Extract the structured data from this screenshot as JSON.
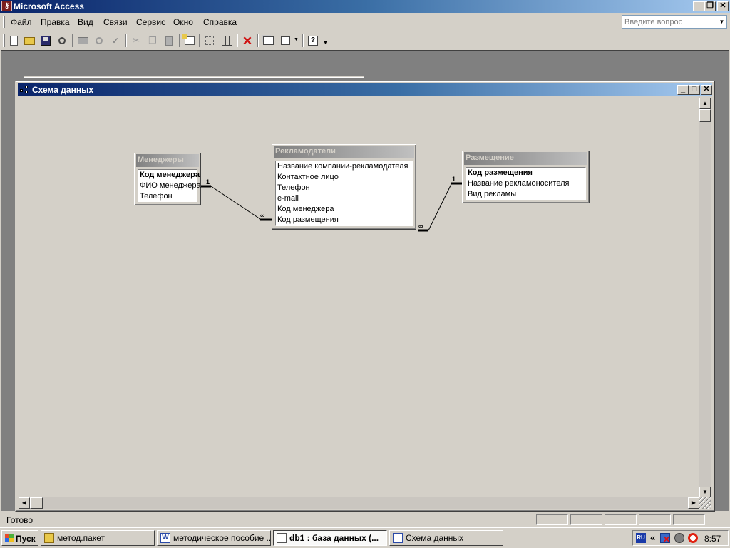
{
  "app": {
    "title": "Microsoft Access",
    "icon": "access-key-icon",
    "caption_buttons": {
      "minimize": "_",
      "restore": "❐",
      "close": "✕"
    }
  },
  "menu": {
    "items": [
      "Файл",
      "Правка",
      "Вид",
      "Связи",
      "Сервис",
      "Окно",
      "Справка"
    ],
    "help_placeholder": "Введите вопрос"
  },
  "toolbar": {
    "buttons": [
      "new-icon",
      "open-icon",
      "save-icon",
      "file-search-icon",
      "print-icon",
      "print-preview-icon",
      "spelling-icon",
      "cut-icon",
      "copy-icon",
      "paste-icon",
      "show-table-icon",
      "show-direct-icon",
      "show-all-icon",
      "delete-icon",
      "database-window-icon",
      "new-object-icon",
      "help-icon"
    ]
  },
  "child_window": {
    "title": "Схема данных",
    "icon": "relationships-icon"
  },
  "tables": [
    {
      "name": "Менеджеры",
      "fields": [
        {
          "label": "Код менеджера",
          "key": true
        },
        {
          "label": "ФИО менеджера",
          "key": false
        },
        {
          "label": "Телефон",
          "key": false
        }
      ]
    },
    {
      "name": "Рекламодатели",
      "fields": [
        {
          "label": "Название компании-рекламодателя",
          "key": false
        },
        {
          "label": "Контактное лицо",
          "key": false
        },
        {
          "label": "Телефон",
          "key": false
        },
        {
          "label": "e-mail",
          "key": false
        },
        {
          "label": "Код менеджера",
          "key": false
        },
        {
          "label": "Код размещения",
          "key": false
        }
      ]
    },
    {
      "name": "Размещение",
      "fields": [
        {
          "label": "Код размещения",
          "key": true
        },
        {
          "label": "Название рекламоносителя",
          "key": false
        },
        {
          "label": "Вид рекламы",
          "key": false
        }
      ]
    }
  ],
  "relationships": [
    {
      "from_table": "Менеджеры",
      "from_field": "Код менеджера",
      "to_table": "Рекламодатели",
      "to_field": "Код менеджера",
      "one_label": "1",
      "many_label": "∞"
    },
    {
      "from_table": "Размещение",
      "from_field": "Код размещения",
      "to_table": "Рекламодатели",
      "to_field": "Код размещения",
      "one_label": "1",
      "many_label": "∞"
    }
  ],
  "status": {
    "text": "Готово"
  },
  "taskbar": {
    "start_label": "Пуск",
    "buttons": [
      {
        "label": "метод.пакет",
        "icon": "folder-icon",
        "active": false
      },
      {
        "label": "методическое пособие ...",
        "icon": "word-icon",
        "active": false
      },
      {
        "label": "db1 : база данных (...",
        "icon": "access-icon",
        "active": true
      },
      {
        "label": "Схема данных",
        "icon": "relationships-icon",
        "active": false
      }
    ],
    "tray": {
      "language": "RU",
      "chevron": "«",
      "clock": "8:57"
    }
  }
}
